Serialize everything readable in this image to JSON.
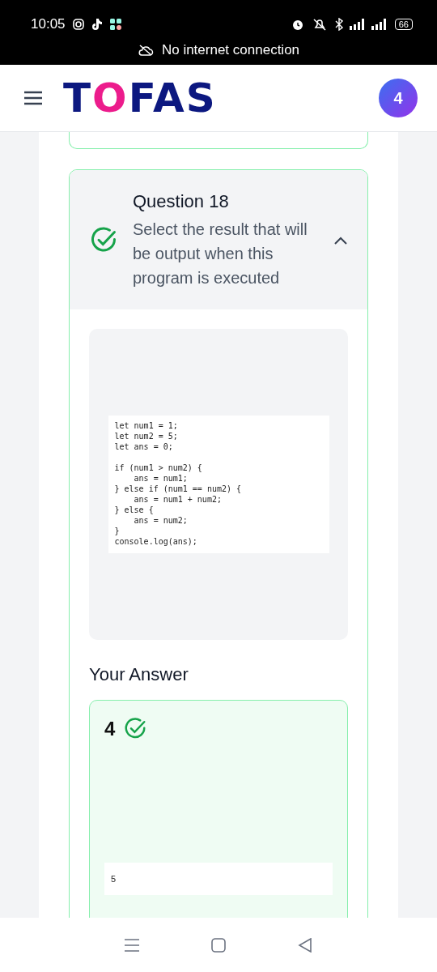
{
  "status_bar": {
    "time": "10:05",
    "battery": "66",
    "notice": "No internet connection"
  },
  "header": {
    "logo": "TOFAS",
    "avatar": "4"
  },
  "question": {
    "title": "Question 18",
    "text": "Select the result that will be output when this program is executed",
    "correct": true,
    "expanded": true,
    "code": [
      [
        "let num1 = 1;",
        "let num2 = 5;",
        "let ans = 0;"
      ],
      [
        "if (num1 > num2) {",
        "    ans = num1;",
        "} else if (num1 == num2) {",
        "    ans = num1 + num2;",
        "} else {",
        "    ans = num2;",
        "}",
        "console.log(ans);"
      ]
    ]
  },
  "answer": {
    "heading": "Your Answer",
    "value": "4",
    "correct": true,
    "output": "5"
  }
}
